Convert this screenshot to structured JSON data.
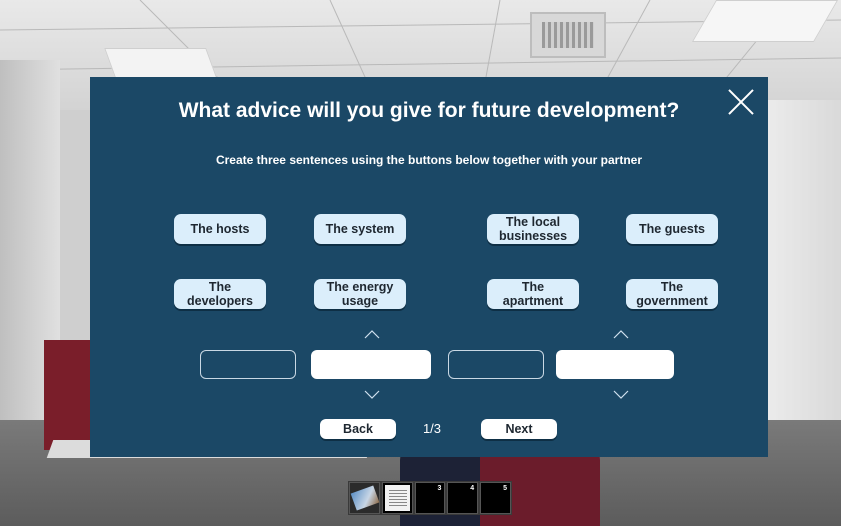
{
  "dialog": {
    "title": "What advice will you give for future development?",
    "subtitle": "Create three sentences using the buttons below together with your partner",
    "word_buttons": [
      {
        "label": "The hosts"
      },
      {
        "label": "The system"
      },
      {
        "label": "The local businesses"
      },
      {
        "label": "The guests"
      },
      {
        "label": "The developers"
      },
      {
        "label": "The energy usage"
      },
      {
        "label": "The apartment"
      },
      {
        "label": "The government"
      }
    ],
    "navigation": {
      "back_label": "Back",
      "next_label": "Next",
      "page_indicator": "1/3"
    }
  },
  "inventory": {
    "slots": [
      {
        "number": "",
        "content": "photo"
      },
      {
        "number": "",
        "content": "document"
      },
      {
        "number": "3",
        "content": "empty"
      },
      {
        "number": "4",
        "content": "empty"
      },
      {
        "number": "5",
        "content": "empty"
      }
    ]
  },
  "colors": {
    "panel_bg": "#1b4866",
    "word_button_bg": "#dbeefb",
    "text_light": "#ffffff",
    "text_dark": "#1e2730"
  },
  "icons": {
    "close": "close-icon",
    "chevron_up": "chevron-up-icon",
    "chevron_down": "chevron-down-icon"
  }
}
